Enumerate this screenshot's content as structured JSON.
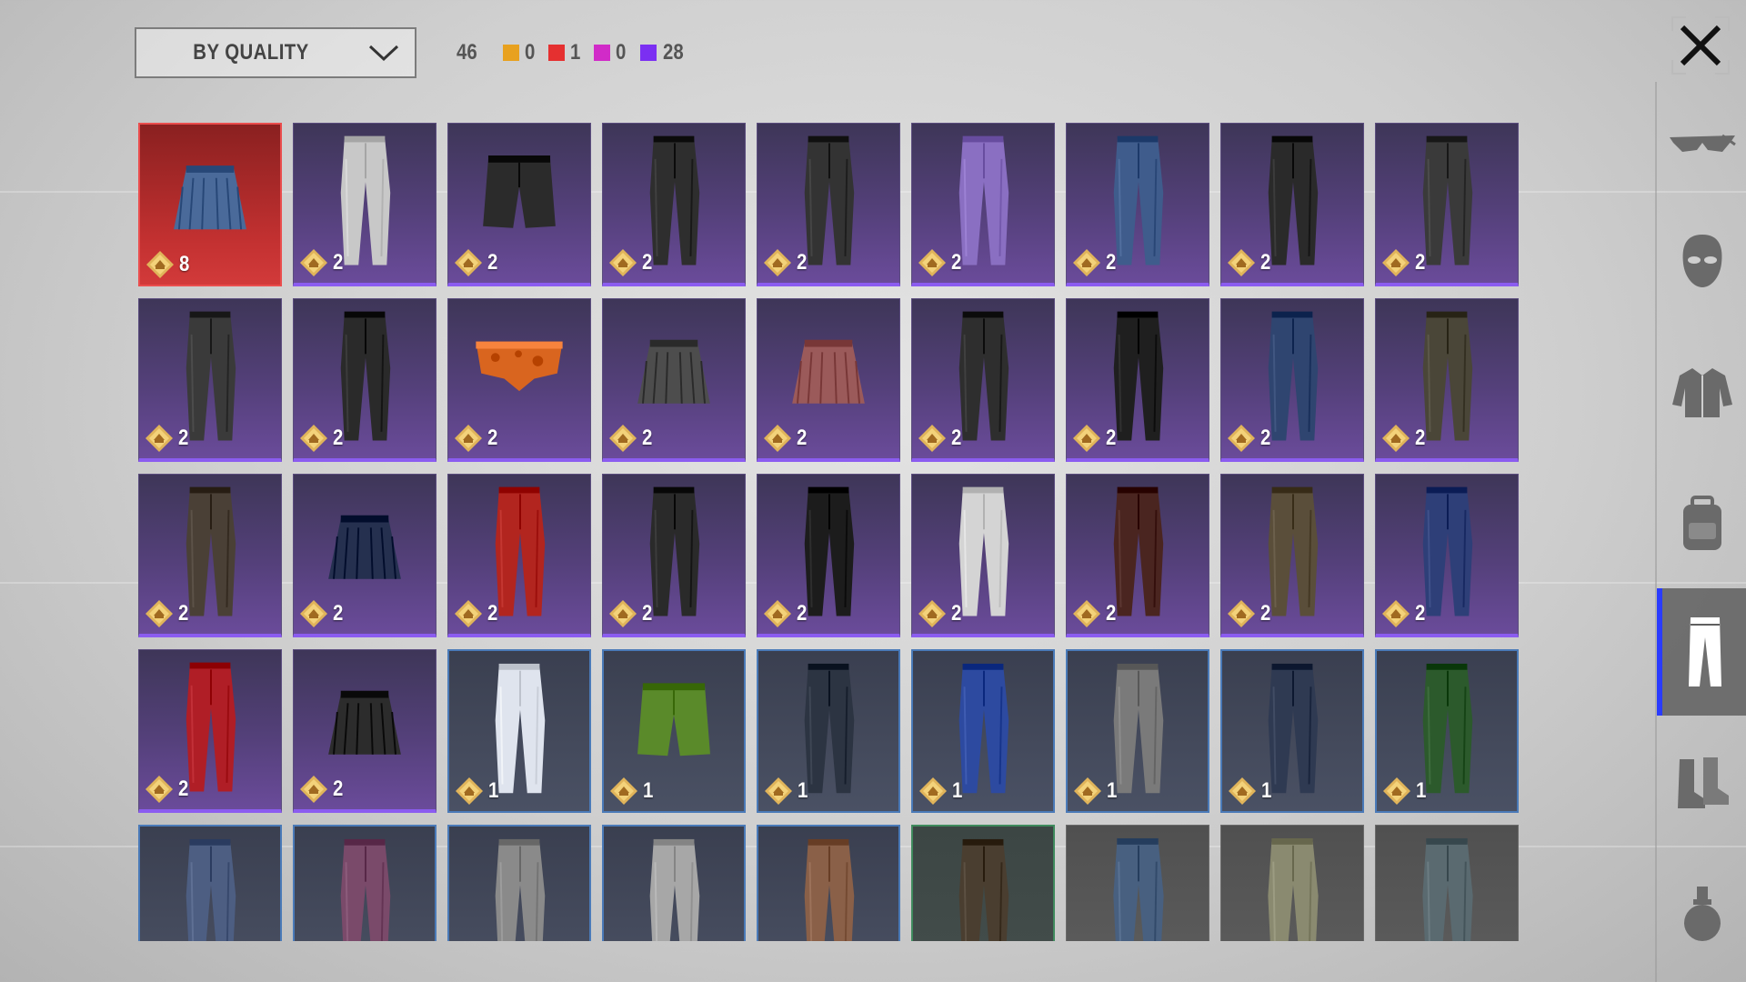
{
  "header": {
    "sort_label": "BY QUALITY",
    "total_count": "46",
    "quality_counts": [
      {
        "color": "#e8a11f",
        "count": "0"
      },
      {
        "color": "#e53030",
        "count": "1"
      },
      {
        "color": "#d12bc8",
        "count": "0"
      },
      {
        "color": "#7b2ff2",
        "count": "28"
      }
    ]
  },
  "close_icon": "close-icon",
  "sidebar": {
    "tabs": [
      {
        "icon": "glasses-icon",
        "active": false
      },
      {
        "icon": "mask-icon",
        "active": false
      },
      {
        "icon": "jacket-icon",
        "active": false
      },
      {
        "icon": "backpack-icon",
        "active": false
      },
      {
        "icon": "pants-icon",
        "active": true
      },
      {
        "icon": "boots-icon",
        "active": false
      },
      {
        "icon": "grenade-icon",
        "active": false
      }
    ]
  },
  "items": [
    {
      "quality": "red",
      "cost": "8",
      "kind": "skirt",
      "color": "#4a6a9a"
    },
    {
      "quality": "purple",
      "cost": "2",
      "kind": "pants",
      "color": "#c8c8c8"
    },
    {
      "quality": "purple",
      "cost": "2",
      "kind": "shorts",
      "color": "#2b2b2b"
    },
    {
      "quality": "purple",
      "cost": "2",
      "kind": "pants",
      "color": "#2e2e2e"
    },
    {
      "quality": "purple",
      "cost": "2",
      "kind": "pants",
      "color": "#333333"
    },
    {
      "quality": "purple",
      "cost": "2",
      "kind": "pants",
      "color": "#8a6fc2"
    },
    {
      "quality": "purple",
      "cost": "2",
      "kind": "pants",
      "color": "#3f5c8c"
    },
    {
      "quality": "purple",
      "cost": "2",
      "kind": "pants",
      "color": "#2a2a2a"
    },
    {
      "quality": "purple",
      "cost": "2",
      "kind": "pants",
      "color": "#3a3a3a"
    },
    {
      "quality": "purple",
      "cost": "2",
      "kind": "pants",
      "color": "#3a3a3a"
    },
    {
      "quality": "purple",
      "cost": "2",
      "kind": "pants",
      "color": "#2a2a2a"
    },
    {
      "quality": "purple",
      "cost": "2",
      "kind": "briefs",
      "color": "#d9651f"
    },
    {
      "quality": "purple",
      "cost": "2",
      "kind": "skirt",
      "color": "#4d4d4d"
    },
    {
      "quality": "purple",
      "cost": "2",
      "kind": "skirt",
      "color": "#9b5a5a"
    },
    {
      "quality": "purple",
      "cost": "2",
      "kind": "pants",
      "color": "#2e2e2e"
    },
    {
      "quality": "purple",
      "cost": "2",
      "kind": "pants",
      "color": "#1f1f1f"
    },
    {
      "quality": "purple",
      "cost": "2",
      "kind": "pants",
      "color": "#2f4570"
    },
    {
      "quality": "purple",
      "cost": "2",
      "kind": "pants",
      "color": "#4a4638"
    },
    {
      "quality": "purple",
      "cost": "2",
      "kind": "pants",
      "color": "#4a4036"
    },
    {
      "quality": "purple",
      "cost": "2",
      "kind": "skirt",
      "color": "#25304f"
    },
    {
      "quality": "purple",
      "cost": "2",
      "kind": "pants",
      "color": "#b2251f"
    },
    {
      "quality": "purple",
      "cost": "2",
      "kind": "pants",
      "color": "#2a2a2a"
    },
    {
      "quality": "purple",
      "cost": "2",
      "kind": "pants",
      "color": "#1c1c1c"
    },
    {
      "quality": "purple",
      "cost": "2",
      "kind": "pants",
      "color": "#d4d4d4"
    },
    {
      "quality": "purple",
      "cost": "2",
      "kind": "pants",
      "color": "#4a2520"
    },
    {
      "quality": "purple",
      "cost": "2",
      "kind": "pants",
      "color": "#5a4e3a"
    },
    {
      "quality": "purple",
      "cost": "2",
      "kind": "pants",
      "color": "#2e3f78"
    },
    {
      "quality": "purple",
      "cost": "2",
      "kind": "pants",
      "color": "#b01e26"
    },
    {
      "quality": "purple",
      "cost": "2",
      "kind": "skirt",
      "color": "#2c2c2c"
    },
    {
      "quality": "blue",
      "cost": "1",
      "kind": "pants",
      "color": "#dfe4ee"
    },
    {
      "quality": "blue",
      "cost": "1",
      "kind": "shorts",
      "color": "#5a8a2a"
    },
    {
      "quality": "blue",
      "cost": "1",
      "kind": "pants",
      "color": "#2c3442"
    },
    {
      "quality": "blue",
      "cost": "1",
      "kind": "pants",
      "color": "#2d4aa0"
    },
    {
      "quality": "blue",
      "cost": "1",
      "kind": "pants",
      "color": "#7a7a7a"
    },
    {
      "quality": "blue",
      "cost": "1",
      "kind": "pants",
      "color": "#2f3a52"
    },
    {
      "quality": "blue",
      "cost": "1",
      "kind": "pants",
      "color": "#2c5a2c"
    },
    {
      "quality": "blue",
      "cost": "",
      "kind": "pants",
      "color": "#4d5e82"
    },
    {
      "quality": "blue",
      "cost": "",
      "kind": "pants",
      "color": "#7a4a6a"
    },
    {
      "quality": "blue",
      "cost": "",
      "kind": "pants",
      "color": "#8a8a8a"
    },
    {
      "quality": "blue",
      "cost": "",
      "kind": "pants",
      "color": "#a7a7a7"
    },
    {
      "quality": "blue",
      "cost": "",
      "kind": "pants",
      "color": "#8a6048"
    },
    {
      "quality": "green",
      "cost": "",
      "kind": "pants",
      "color": "#4a3e30"
    },
    {
      "quality": "gray",
      "cost": "",
      "kind": "pants",
      "color": "#486080"
    },
    {
      "quality": "gray",
      "cost": "",
      "kind": "pants",
      "color": "#8a8a70"
    },
    {
      "quality": "gray",
      "cost": "",
      "kind": "pants",
      "color": "#5a6a70"
    }
  ]
}
